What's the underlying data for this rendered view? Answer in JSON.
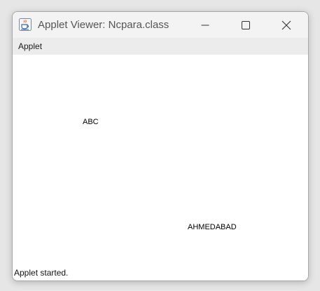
{
  "window": {
    "title": "Applet Viewer: Ncpara.class",
    "app_icon": "java-cup-icon",
    "controls": [
      "minimize-icon",
      "maximize-icon",
      "close-icon"
    ]
  },
  "menu": {
    "items": [
      {
        "label": "Applet"
      }
    ]
  },
  "applet": {
    "strings": [
      "ABC",
      "AHMEDABAD"
    ]
  },
  "status": {
    "text": "Applet started."
  },
  "colors": {
    "title_text": "#555555",
    "titlebar_bg": "#f3f3f3",
    "menubar_bg": "#ececec",
    "canvas_bg": "#ffffff"
  }
}
